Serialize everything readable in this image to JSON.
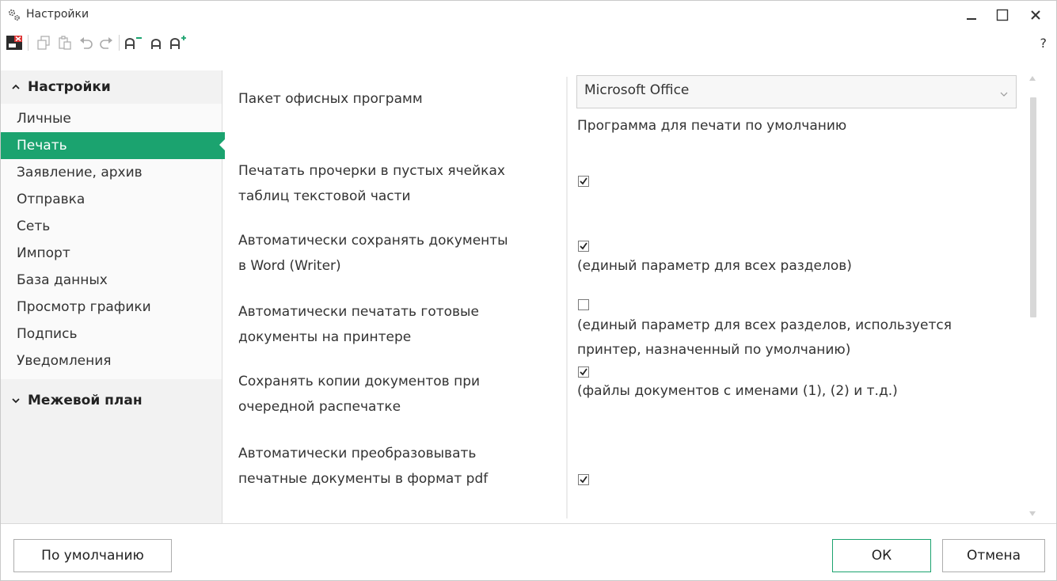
{
  "window": {
    "title": "Настройки",
    "icon": "gears-icon",
    "controls": [
      "minimize-icon",
      "maximize-icon",
      "close-icon"
    ]
  },
  "toolbar": {
    "icons": [
      "close-doc-icon",
      "copy-icon",
      "paste-icon",
      "undo-icon",
      "redo-icon",
      "font-decrease-icon",
      "font-normal-icon",
      "font-increase-icon"
    ],
    "help_label": "?"
  },
  "sidebar": {
    "groups": [
      {
        "label": "Настройки",
        "expanded": true,
        "items": [
          {
            "label": "Личные"
          },
          {
            "label": "Печать",
            "active": true
          },
          {
            "label": "Заявление, архив"
          },
          {
            "label": "Отправка"
          },
          {
            "label": "Сеть"
          },
          {
            "label": "Импорт"
          },
          {
            "label": "База данных"
          },
          {
            "label": "Просмотр графики"
          },
          {
            "label": "Подпись"
          },
          {
            "label": "Уведомления"
          }
        ]
      },
      {
        "label": "Межевой план",
        "expanded": false
      }
    ]
  },
  "settings": {
    "office_suite": {
      "label": "Пакет офисных программ",
      "value": "Microsoft Office",
      "hint": "Программа для печати по умолчанию"
    },
    "print_dashes": {
      "label_line1": "Печатать прочерки в пустых ячейках",
      "label_line2": "таблиц текстовой части",
      "checked": true
    },
    "autosave_word": {
      "label_line1": "Автоматически сохранять документы",
      "label_line2": "в Word (Writer)",
      "checked": true,
      "note": "(единый параметр для всех разделов)"
    },
    "autoprint": {
      "label_line1": "Автоматически печатать готовые",
      "label_line2": "документы на принтере",
      "checked": false,
      "note_line1": "(единый параметр для всех разделов, используется",
      "note_line2": "принтер, назначенный по умолчанию)"
    },
    "keep_copies": {
      "label_line1": "Сохранять копии документов при",
      "label_line2": "очередной распечатке",
      "checked": true,
      "note": "(файлы документов с именами (1), (2) и т.д.)"
    },
    "convert_pdf": {
      "label_line1": "Автоматически преобразовывать",
      "label_line2": "печатные документы в формат pdf",
      "checked": true
    }
  },
  "footer": {
    "defaults_label": "По умолчанию",
    "ok_label": "ОК",
    "cancel_label": "Отмена"
  },
  "colors": {
    "accent": "#1ba36f",
    "sidebar_bg": "#f2f2f2"
  }
}
